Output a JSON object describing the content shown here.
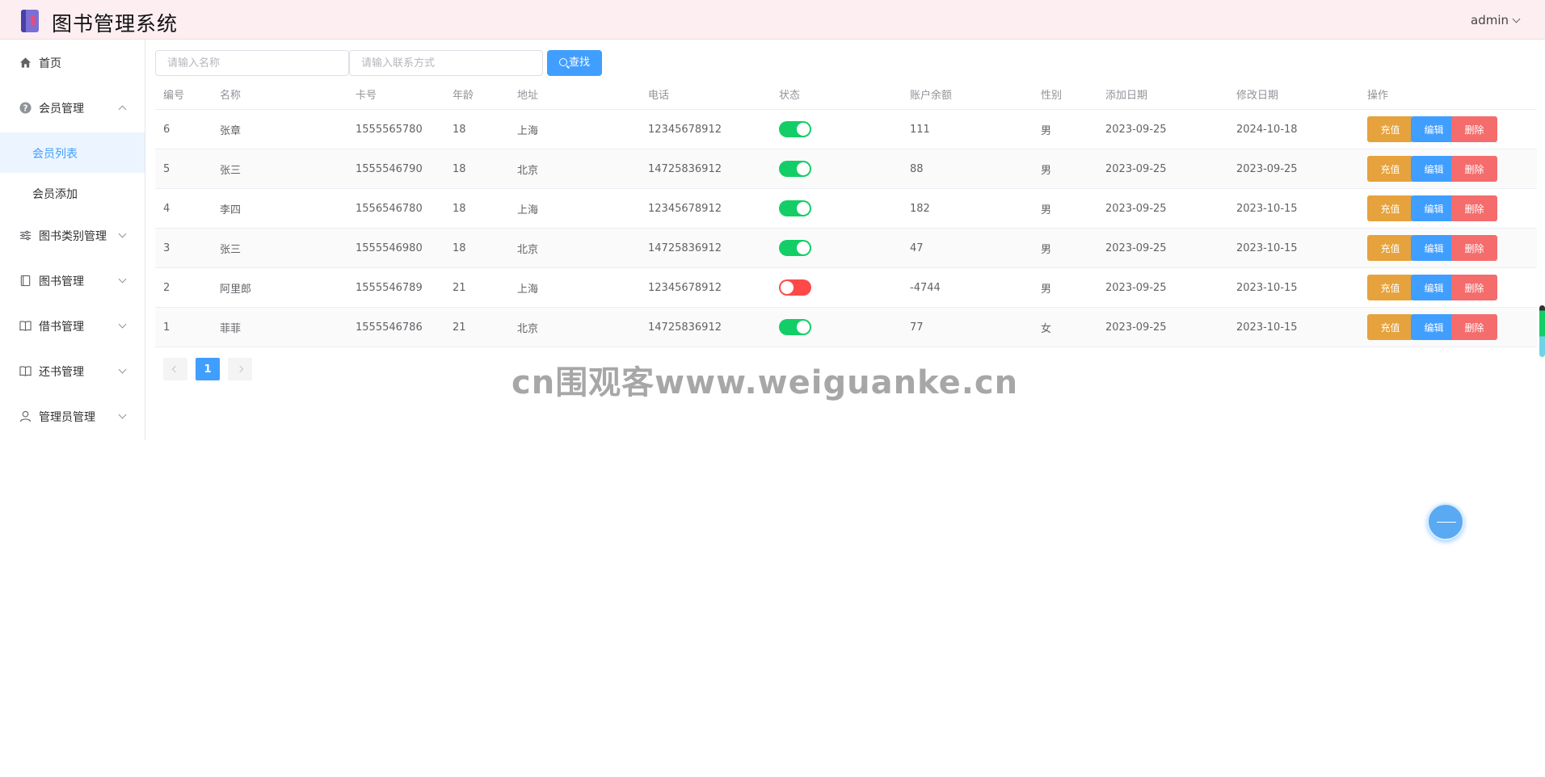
{
  "app": {
    "title": "图书管理系统",
    "user": "admin"
  },
  "sidebar": {
    "items": [
      {
        "label": "首页",
        "icon": "home-icon"
      },
      {
        "label": "会员管理",
        "icon": "question-circle-icon",
        "expanded": true,
        "children": [
          {
            "label": "会员列表",
            "active": true
          },
          {
            "label": "会员添加"
          }
        ]
      },
      {
        "label": "图书类别管理",
        "icon": "sliders-icon"
      },
      {
        "label": "图书管理",
        "icon": "book-icon"
      },
      {
        "label": "借书管理",
        "icon": "open-book-icon"
      },
      {
        "label": "还书管理",
        "icon": "open-book-icon"
      },
      {
        "label": "管理员管理",
        "icon": "user-icon"
      }
    ]
  },
  "search": {
    "name_placeholder": "请输入名称",
    "phone_placeholder": "请输入联系方式",
    "button_label": "查找"
  },
  "table": {
    "columns": [
      "编号",
      "名称",
      "卡号",
      "年龄",
      "地址",
      "电话",
      "状态",
      "账户余额",
      "性别",
      "添加日期",
      "修改日期",
      "操作"
    ],
    "rows": [
      {
        "id": "6",
        "name": "张章",
        "card": "1555565780",
        "age": "18",
        "address": "上海",
        "phone": "12345678912",
        "status": true,
        "balance": "111",
        "gender": "男",
        "added": "2023-09-25",
        "modified": "2024-10-18"
      },
      {
        "id": "5",
        "name": "张三",
        "card": "1555546790",
        "age": "18",
        "address": "北京",
        "phone": "14725836912",
        "status": true,
        "balance": "88",
        "gender": "男",
        "added": "2023-09-25",
        "modified": "2023-09-25"
      },
      {
        "id": "4",
        "name": "李四",
        "card": "1556546780",
        "age": "18",
        "address": "上海",
        "phone": "12345678912",
        "status": true,
        "balance": "182",
        "gender": "男",
        "added": "2023-09-25",
        "modified": "2023-10-15"
      },
      {
        "id": "3",
        "name": "张三",
        "card": "1555546980",
        "age": "18",
        "address": "北京",
        "phone": "14725836912",
        "status": true,
        "balance": "47",
        "gender": "男",
        "added": "2023-09-25",
        "modified": "2023-10-15"
      },
      {
        "id": "2",
        "name": "阿里郎",
        "card": "1555546789",
        "age": "21",
        "address": "上海",
        "phone": "12345678912",
        "status": false,
        "balance": "-4744",
        "gender": "男",
        "added": "2023-09-25",
        "modified": "2023-10-15"
      },
      {
        "id": "1",
        "name": "菲菲",
        "card": "1555546786",
        "age": "21",
        "address": "北京",
        "phone": "14725836912",
        "status": true,
        "balance": "77",
        "gender": "女",
        "added": "2023-09-25",
        "modified": "2023-10-15"
      }
    ],
    "actions": {
      "recharge": "充值",
      "edit": "编辑",
      "delete": "删除"
    }
  },
  "pagination": {
    "current": "1"
  },
  "watermark": "cn围观客www.weiguanke.cn",
  "colors": {
    "primary": "#409eff",
    "warning": "#e6a23c",
    "danger": "#f56c6c",
    "success": "#13ce66",
    "switch_off": "#ff4949",
    "header_bg": "#fdeef2"
  }
}
